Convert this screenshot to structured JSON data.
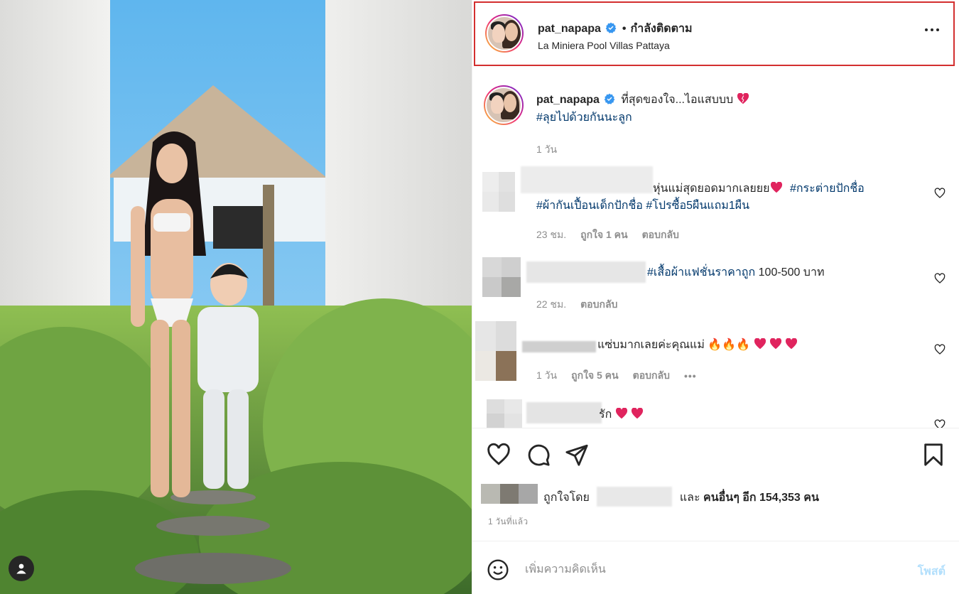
{
  "post": {
    "author": "pat_napapa",
    "follow_status": "กำลังติดตาม",
    "location": "La Miniera Pool Villas Pattaya",
    "caption_text": "ที่สุดของใจ...ไอแสบบบ",
    "caption_hashtag": "#ลุยไปด้วยกันนะลูก",
    "caption_time": "1 วัน",
    "likes_prefix": "ถูกใจโดย",
    "likes_suffix_and": "และ",
    "likes_suffix_others": "คนอื่นๆ อีก 154,353 คน",
    "post_date": "1 วันที่แล้ว"
  },
  "comments": [
    {
      "text": "หุ่นแม่สุดยอดมากเลยยย",
      "hashtags_line1": "#กระต่ายปักชื่อ",
      "hashtags_line2": "#ผ้ากันเปื้อนเด็กปักชื่อ #โปรซื้อ5ผืนแถม1ผืน",
      "time": "23 ชม.",
      "likes": "ถูกใจ 1 คน",
      "reply": "ตอบกลับ"
    },
    {
      "hashtag": "#เสื้อผ้าแฟชั่นราคาถูก",
      "text": "100-500 บาท",
      "time": "22 ชม.",
      "reply": "ตอบกลับ"
    },
    {
      "text": "แซ่บมากเลยค่ะคุณแม่",
      "time": "1 วัน",
      "likes": "ถูกใจ 5 คน",
      "reply": "ตอบกลับ",
      "more": "•••"
    },
    {
      "text": "รัก"
    }
  ],
  "comment_box": {
    "placeholder": "เพิ่มความคิดเห็น",
    "post_label": "โพสต์"
  },
  "icons": {
    "verified": "verified-badge-icon",
    "heart": "heart-icon",
    "comment": "comment-icon",
    "share": "share-icon",
    "save": "bookmark-icon",
    "emoji": "emoji-icon",
    "more": "more-icon",
    "tag": "user-tag-icon"
  },
  "colors": {
    "hashtag": "#00376b",
    "verified": "#3897f0",
    "highlight_border": "#d32f2f",
    "post_button": "#b2dffc",
    "heart_emoji": "#e0245e"
  }
}
